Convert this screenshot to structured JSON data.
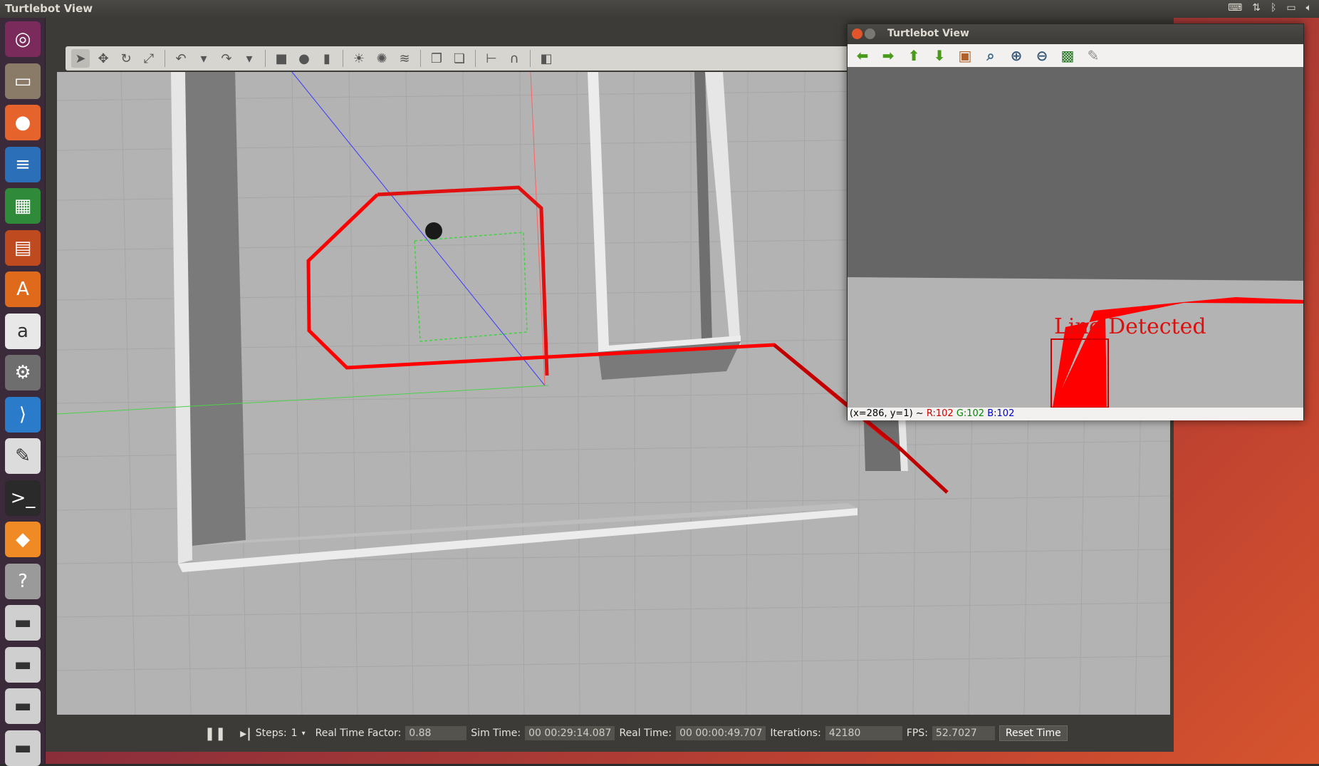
{
  "topbar": {
    "title": "Turtlebot View",
    "indicators": [
      "keyboard-icon",
      "network-icon",
      "bluetooth-icon",
      "battery-icon",
      "volume-icon"
    ]
  },
  "launcher": {
    "items": [
      {
        "name": "ubuntu-dash",
        "glyph": "◎",
        "bg": "#7a2b5c"
      },
      {
        "name": "files",
        "glyph": "▭",
        "bg": "#8a7a68"
      },
      {
        "name": "firefox",
        "glyph": "●",
        "bg": "#e6632c"
      },
      {
        "name": "libreoffice-writer",
        "glyph": "≡",
        "bg": "#2a6fb8"
      },
      {
        "name": "libreoffice-calc",
        "glyph": "▦",
        "bg": "#2f8a3a"
      },
      {
        "name": "libreoffice-impress",
        "glyph": "▤",
        "bg": "#c04a20"
      },
      {
        "name": "software-center",
        "glyph": "A",
        "bg": "#e06a1c"
      },
      {
        "name": "amazon",
        "glyph": "a",
        "bg": "#e8e8e8"
      },
      {
        "name": "system-settings",
        "glyph": "⚙",
        "bg": "#6e6e6e"
      },
      {
        "name": "vscode",
        "glyph": "⟩",
        "bg": "#2a7ccb"
      },
      {
        "name": "text-editor",
        "glyph": "✎",
        "bg": "#dcdcdc"
      },
      {
        "name": "terminal",
        "glyph": ">_",
        "bg": "#2a2a2a"
      },
      {
        "name": "gazebo",
        "glyph": "◆",
        "bg": "#f08a24"
      },
      {
        "name": "help",
        "glyph": "?",
        "bg": "#9a9a9a"
      },
      {
        "name": "drive-1",
        "glyph": "▬",
        "bg": "#cfcfcf"
      },
      {
        "name": "drive-2",
        "glyph": "▬",
        "bg": "#cfcfcf"
      },
      {
        "name": "drive-3",
        "glyph": "▬",
        "bg": "#cfcfcf"
      },
      {
        "name": "drive-4",
        "glyph": "▬",
        "bg": "#cfcfcf"
      }
    ]
  },
  "gazebo_toolbar": {
    "icons": [
      {
        "name": "select-mode-icon",
        "glyph": "➤",
        "active": true
      },
      {
        "name": "translate-mode-icon",
        "glyph": "✥"
      },
      {
        "name": "rotate-mode-icon",
        "glyph": "↻"
      },
      {
        "name": "scale-mode-icon",
        "glyph": "⤢"
      },
      {
        "sep": true
      },
      {
        "name": "undo-icon",
        "glyph": "↶"
      },
      {
        "name": "undo-dropdown-icon",
        "glyph": "▾"
      },
      {
        "name": "redo-icon",
        "glyph": "↷"
      },
      {
        "name": "redo-dropdown-icon",
        "glyph": "▾"
      },
      {
        "sep": true
      },
      {
        "name": "box-shape-icon",
        "glyph": "■"
      },
      {
        "name": "sphere-shape-icon",
        "glyph": "●"
      },
      {
        "name": "cylinder-shape-icon",
        "glyph": "▮"
      },
      {
        "sep": true
      },
      {
        "name": "point-light-icon",
        "glyph": "☀"
      },
      {
        "name": "spot-light-icon",
        "glyph": "✺"
      },
      {
        "name": "directional-light-icon",
        "glyph": "≋"
      },
      {
        "sep": true
      },
      {
        "name": "copy-icon",
        "glyph": "❐"
      },
      {
        "name": "paste-icon",
        "glyph": "❏"
      },
      {
        "sep": true
      },
      {
        "name": "align-icon",
        "glyph": "⊢"
      },
      {
        "name": "snap-icon",
        "glyph": "∩"
      },
      {
        "sep": true
      },
      {
        "name": "view-angle-icon",
        "glyph": "◧"
      }
    ]
  },
  "status": {
    "steps_label": "Steps:",
    "steps_value": "1",
    "rtf_label": "Real Time Factor:",
    "rtf_value": "0.88",
    "sim_time_label": "Sim Time:",
    "sim_time_value": "00 00:29:14.087",
    "real_time_label": "Real Time:",
    "real_time_value": "00 00:00:49.707",
    "iterations_label": "Iterations:",
    "iterations_value": "42180",
    "fps_label": "FPS:",
    "fps_value": "52.7027",
    "reset_label": "Reset Time"
  },
  "image_window": {
    "title": "Turtlebot View",
    "toolbar_icons": [
      {
        "name": "back-arrow-icon",
        "glyph": "⬅",
        "color": "#4a9a1a"
      },
      {
        "name": "forward-arrow-icon",
        "glyph": "➡",
        "color": "#4a9a1a"
      },
      {
        "name": "up-arrow-icon",
        "glyph": "⬆",
        "color": "#4a9a1a"
      },
      {
        "name": "down-arrow-icon",
        "glyph": "⬇",
        "color": "#4a9a1a"
      },
      {
        "name": "image-icon",
        "glyph": "▣",
        "color": "#b0602a"
      },
      {
        "name": "zoom-fit-icon",
        "glyph": "⌕",
        "color": "#3a6a8a"
      },
      {
        "name": "zoom-in-icon",
        "glyph": "⊕",
        "color": "#3a5a7a"
      },
      {
        "name": "zoom-out-icon",
        "glyph": "⊖",
        "color": "#3a5a7a"
      },
      {
        "name": "save-icon",
        "glyph": "▩",
        "color": "#2a7a2a"
      },
      {
        "name": "properties-icon",
        "glyph": "✎",
        "color": "#8a8a8a"
      }
    ],
    "overlay_text": "Line Detected",
    "status_coord": "(x=286, y=1) ~",
    "status_r": "R:102",
    "status_g": "G:102",
    "status_b": "B:102"
  },
  "colors": {
    "line_red": "#ff0000",
    "line_dark_red": "#a00000",
    "floor": "#b3b3b3",
    "wall": "#e8e8e8",
    "wall_shadow": "#777777"
  }
}
